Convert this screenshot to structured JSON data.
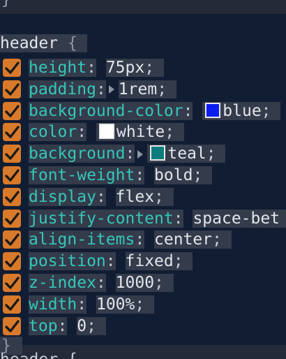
{
  "top_fragment": "}",
  "rule": {
    "selector": "header",
    "open_brace": "{",
    "close_brace": "}",
    "declarations": [
      {
        "property": "height",
        "value": "75px",
        "expander": false,
        "swatch": null
      },
      {
        "property": "padding",
        "value": "1rem",
        "expander": true,
        "swatch": null
      },
      {
        "property": "background-color",
        "value": "blue",
        "expander": false,
        "swatch": "#0b1ef2"
      },
      {
        "property": "color",
        "value": "white",
        "expander": false,
        "swatch": "#ffffff"
      },
      {
        "property": "background",
        "value": "teal",
        "expander": true,
        "swatch": "#0d7c7c"
      },
      {
        "property": "font-weight",
        "value": "bold",
        "expander": false,
        "swatch": null
      },
      {
        "property": "display",
        "value": "flex",
        "expander": false,
        "swatch": null
      },
      {
        "property": "justify-content",
        "value": "space-bet",
        "expander": false,
        "swatch": null
      },
      {
        "property": "align-items",
        "value": "center",
        "expander": false,
        "swatch": null
      },
      {
        "property": "position",
        "value": "fixed",
        "expander": false,
        "swatch": null
      },
      {
        "property": "z-index",
        "value": "1000",
        "expander": false,
        "swatch": null
      },
      {
        "property": "width",
        "value": "100%",
        "expander": false,
        "swatch": null
      },
      {
        "property": "top",
        "value": "0",
        "expander": false,
        "swatch": null
      }
    ]
  },
  "bottom_fragment": "header {",
  "colors": {
    "checkbox": "#d97a2b",
    "property_name": "#35c7b9",
    "panel_background": "#111d33"
  },
  "icons": {
    "checkbox": "checkmark-icon",
    "expander": "expand-triangle-icon",
    "swatch": "color-swatch-icon"
  }
}
